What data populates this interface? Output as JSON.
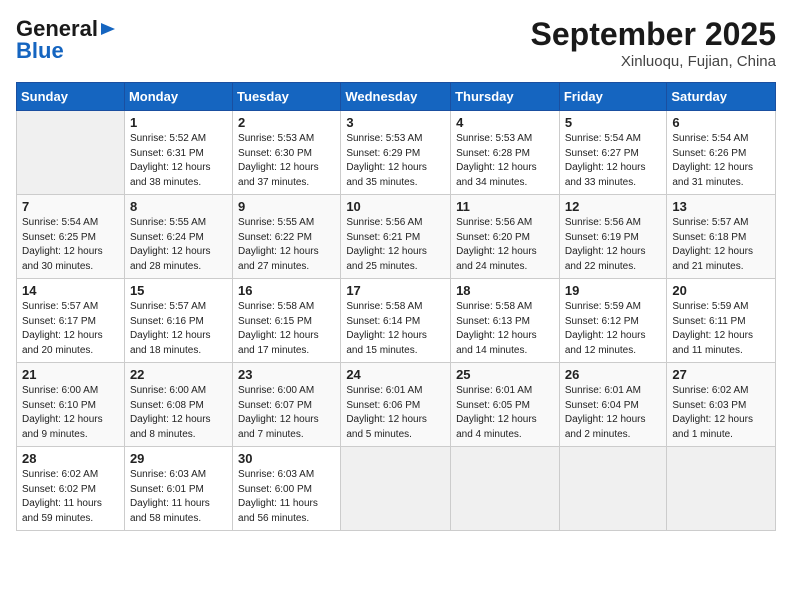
{
  "header": {
    "logo_line1": "General",
    "logo_line2": "Blue",
    "month": "September 2025",
    "location": "Xinluoqu, Fujian, China"
  },
  "weekdays": [
    "Sunday",
    "Monday",
    "Tuesday",
    "Wednesday",
    "Thursday",
    "Friday",
    "Saturday"
  ],
  "weeks": [
    [
      {
        "day": "",
        "info": ""
      },
      {
        "day": "1",
        "info": "Sunrise: 5:52 AM\nSunset: 6:31 PM\nDaylight: 12 hours\nand 38 minutes."
      },
      {
        "day": "2",
        "info": "Sunrise: 5:53 AM\nSunset: 6:30 PM\nDaylight: 12 hours\nand 37 minutes."
      },
      {
        "day": "3",
        "info": "Sunrise: 5:53 AM\nSunset: 6:29 PM\nDaylight: 12 hours\nand 35 minutes."
      },
      {
        "day": "4",
        "info": "Sunrise: 5:53 AM\nSunset: 6:28 PM\nDaylight: 12 hours\nand 34 minutes."
      },
      {
        "day": "5",
        "info": "Sunrise: 5:54 AM\nSunset: 6:27 PM\nDaylight: 12 hours\nand 33 minutes."
      },
      {
        "day": "6",
        "info": "Sunrise: 5:54 AM\nSunset: 6:26 PM\nDaylight: 12 hours\nand 31 minutes."
      }
    ],
    [
      {
        "day": "7",
        "info": "Sunrise: 5:54 AM\nSunset: 6:25 PM\nDaylight: 12 hours\nand 30 minutes."
      },
      {
        "day": "8",
        "info": "Sunrise: 5:55 AM\nSunset: 6:24 PM\nDaylight: 12 hours\nand 28 minutes."
      },
      {
        "day": "9",
        "info": "Sunrise: 5:55 AM\nSunset: 6:22 PM\nDaylight: 12 hours\nand 27 minutes."
      },
      {
        "day": "10",
        "info": "Sunrise: 5:56 AM\nSunset: 6:21 PM\nDaylight: 12 hours\nand 25 minutes."
      },
      {
        "day": "11",
        "info": "Sunrise: 5:56 AM\nSunset: 6:20 PM\nDaylight: 12 hours\nand 24 minutes."
      },
      {
        "day": "12",
        "info": "Sunrise: 5:56 AM\nSunset: 6:19 PM\nDaylight: 12 hours\nand 22 minutes."
      },
      {
        "day": "13",
        "info": "Sunrise: 5:57 AM\nSunset: 6:18 PM\nDaylight: 12 hours\nand 21 minutes."
      }
    ],
    [
      {
        "day": "14",
        "info": "Sunrise: 5:57 AM\nSunset: 6:17 PM\nDaylight: 12 hours\nand 20 minutes."
      },
      {
        "day": "15",
        "info": "Sunrise: 5:57 AM\nSunset: 6:16 PM\nDaylight: 12 hours\nand 18 minutes."
      },
      {
        "day": "16",
        "info": "Sunrise: 5:58 AM\nSunset: 6:15 PM\nDaylight: 12 hours\nand 17 minutes."
      },
      {
        "day": "17",
        "info": "Sunrise: 5:58 AM\nSunset: 6:14 PM\nDaylight: 12 hours\nand 15 minutes."
      },
      {
        "day": "18",
        "info": "Sunrise: 5:58 AM\nSunset: 6:13 PM\nDaylight: 12 hours\nand 14 minutes."
      },
      {
        "day": "19",
        "info": "Sunrise: 5:59 AM\nSunset: 6:12 PM\nDaylight: 12 hours\nand 12 minutes."
      },
      {
        "day": "20",
        "info": "Sunrise: 5:59 AM\nSunset: 6:11 PM\nDaylight: 12 hours\nand 11 minutes."
      }
    ],
    [
      {
        "day": "21",
        "info": "Sunrise: 6:00 AM\nSunset: 6:10 PM\nDaylight: 12 hours\nand 9 minutes."
      },
      {
        "day": "22",
        "info": "Sunrise: 6:00 AM\nSunset: 6:08 PM\nDaylight: 12 hours\nand 8 minutes."
      },
      {
        "day": "23",
        "info": "Sunrise: 6:00 AM\nSunset: 6:07 PM\nDaylight: 12 hours\nand 7 minutes."
      },
      {
        "day": "24",
        "info": "Sunrise: 6:01 AM\nSunset: 6:06 PM\nDaylight: 12 hours\nand 5 minutes."
      },
      {
        "day": "25",
        "info": "Sunrise: 6:01 AM\nSunset: 6:05 PM\nDaylight: 12 hours\nand 4 minutes."
      },
      {
        "day": "26",
        "info": "Sunrise: 6:01 AM\nSunset: 6:04 PM\nDaylight: 12 hours\nand 2 minutes."
      },
      {
        "day": "27",
        "info": "Sunrise: 6:02 AM\nSunset: 6:03 PM\nDaylight: 12 hours\nand 1 minute."
      }
    ],
    [
      {
        "day": "28",
        "info": "Sunrise: 6:02 AM\nSunset: 6:02 PM\nDaylight: 11 hours\nand 59 minutes."
      },
      {
        "day": "29",
        "info": "Sunrise: 6:03 AM\nSunset: 6:01 PM\nDaylight: 11 hours\nand 58 minutes."
      },
      {
        "day": "30",
        "info": "Sunrise: 6:03 AM\nSunset: 6:00 PM\nDaylight: 11 hours\nand 56 minutes."
      },
      {
        "day": "",
        "info": ""
      },
      {
        "day": "",
        "info": ""
      },
      {
        "day": "",
        "info": ""
      },
      {
        "day": "",
        "info": ""
      }
    ]
  ]
}
